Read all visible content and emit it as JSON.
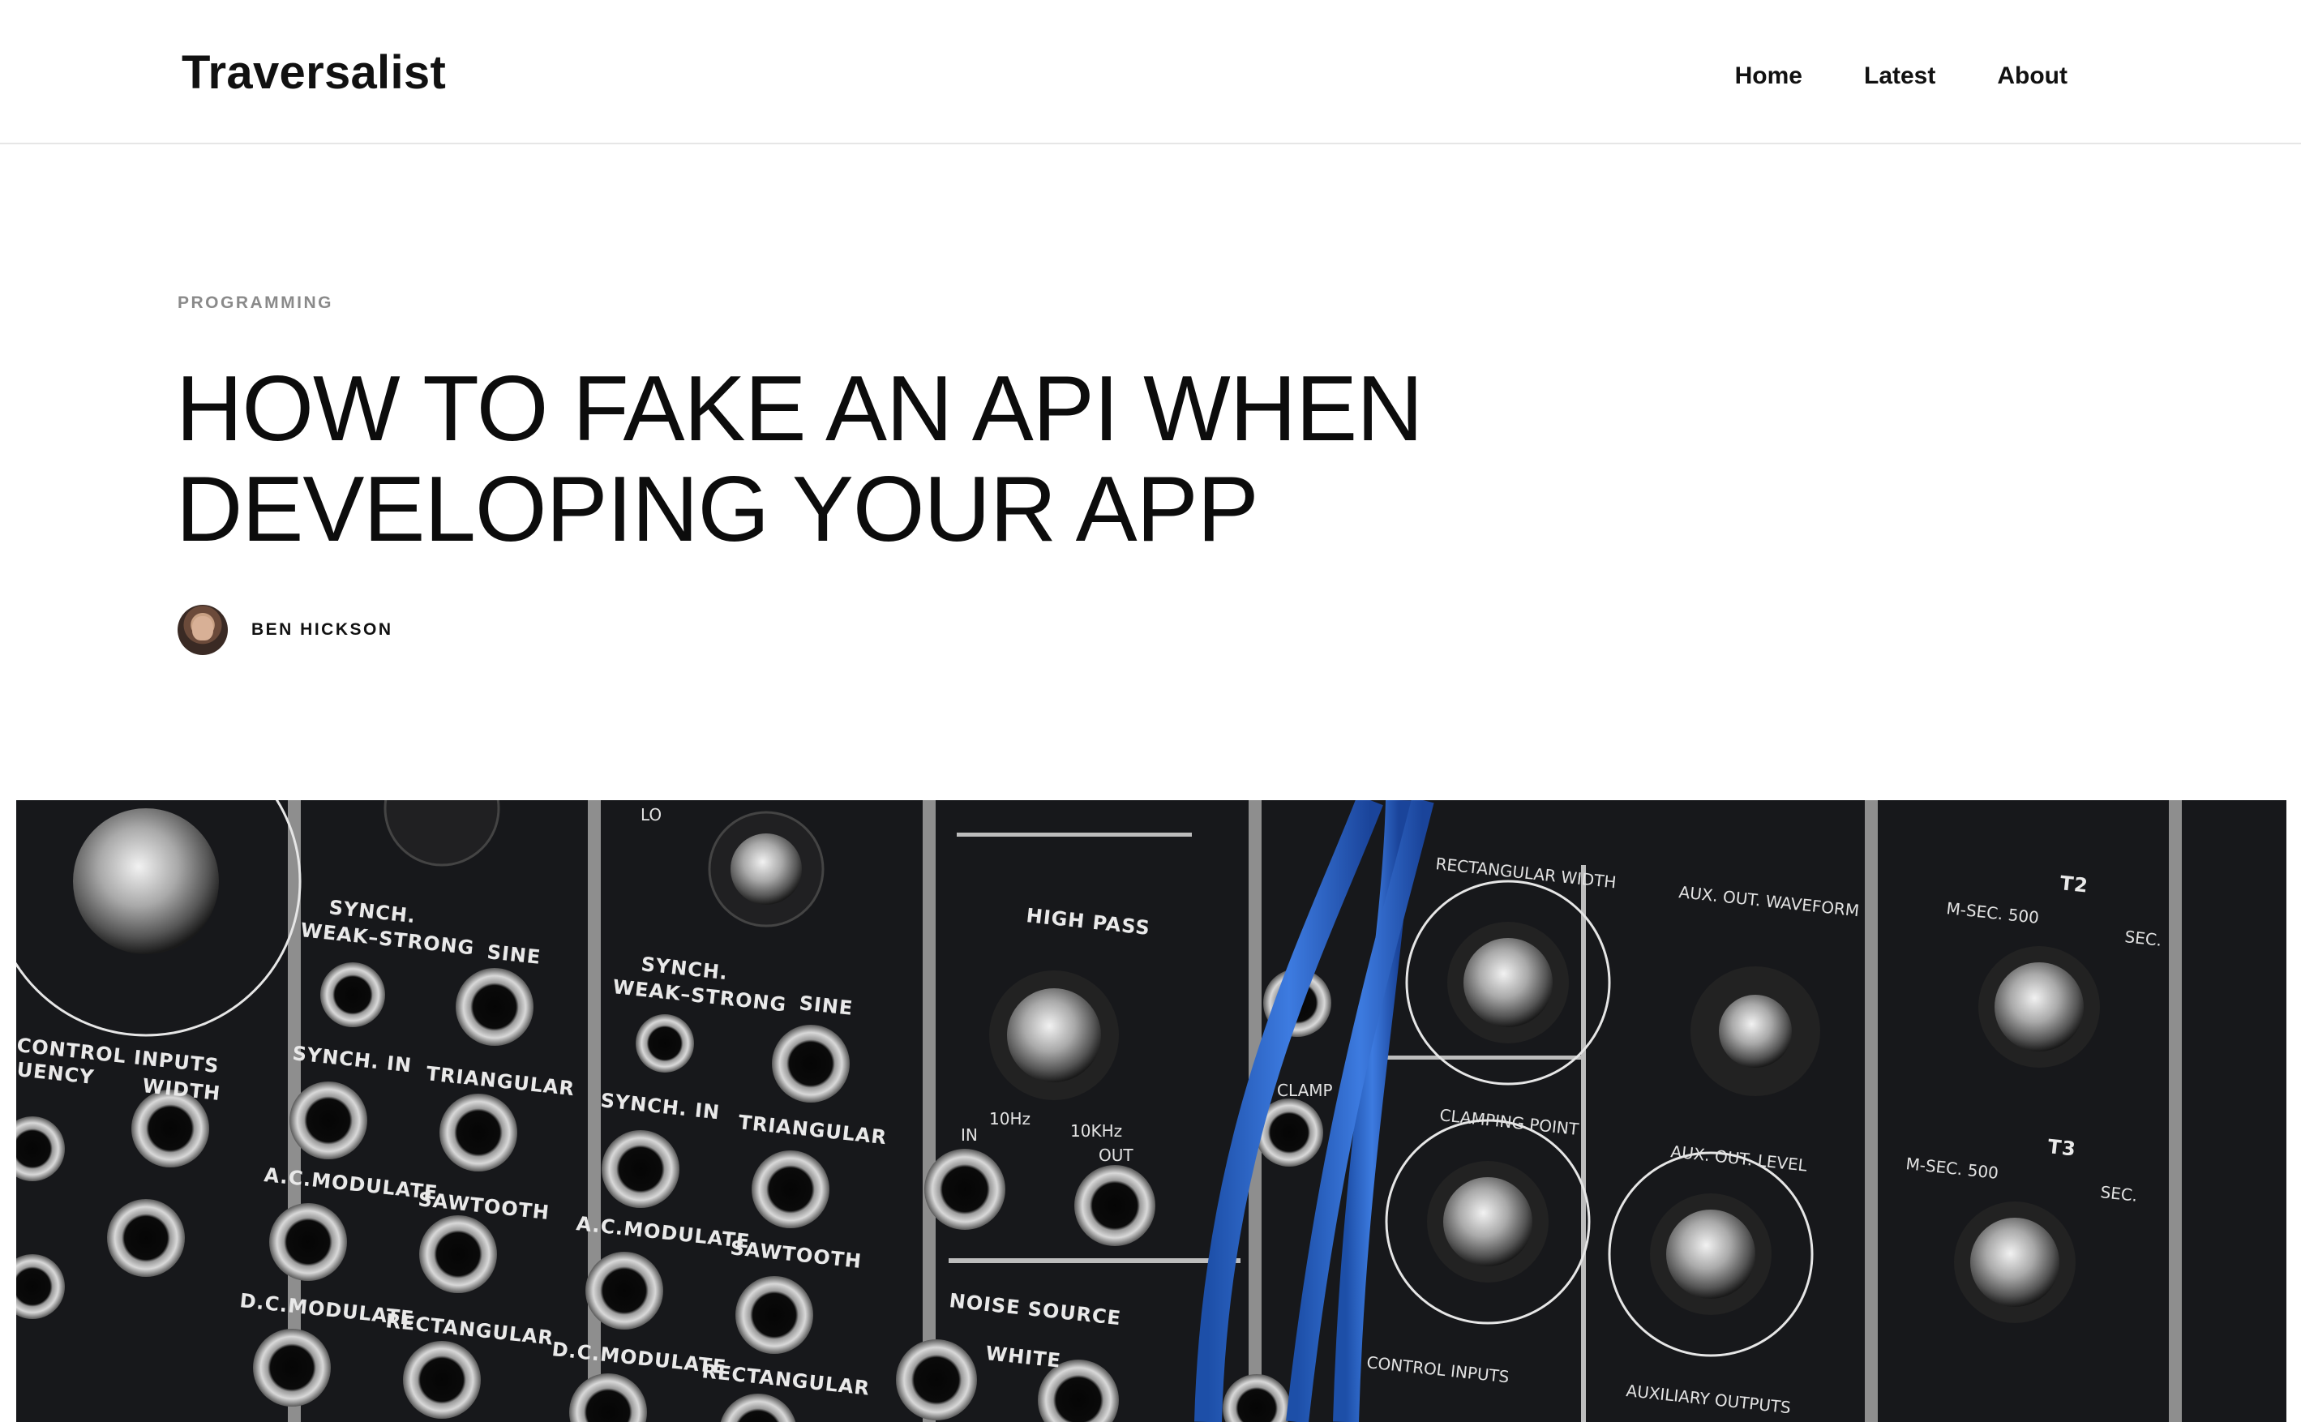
{
  "header": {
    "brand": "Traversalist",
    "nav": [
      {
        "label": "Home"
      },
      {
        "label": "Latest"
      },
      {
        "label": "About"
      }
    ]
  },
  "article": {
    "category": "PROGRAMMING",
    "title_line1": "HOW TO FAKE AN API WHEN",
    "title_line2": "DEVELOPING YOUR APP",
    "author": "BEN HICKSON"
  },
  "hero_labels": {
    "control_inputs": "CONTROL INPUTS",
    "uency": "UENCY",
    "width": "WIDTH",
    "synch_weak_strong_1": "SYNCH.",
    "weak_strong": "WEAK–STRONG",
    "sine": "SINE",
    "synch_in": "SYNCH. IN",
    "triangular": "TRIANGULAR",
    "ac_modulate": "A.C.MODULATE",
    "sawtooth": "SAWTOOTH",
    "dc_modulate": "D.C.MODULATE",
    "rectangular": "RECTANGULAR",
    "high_pass": "HIGH PASS",
    "in": "IN",
    "out": "OUT",
    "hz10": "10Hz",
    "khz10": "10KHz",
    "noise_source": "NOISE SOURCE",
    "white": "WHITE",
    "clamp": "CLAMP",
    "rectangular_width": "RECTANGULAR WIDTH",
    "clamping_point": "CLAMPING POINT",
    "control_inputs_2": "CONTROL INPUTS",
    "aux_out_waveform": "AUX. OUT. WAVEFORM",
    "aux_out_level": "AUX. OUT. LEVEL",
    "auxiliary_outputs": "AUXILIARY OUTPUTS",
    "t2": "T2",
    "t3": "T3",
    "msec500": "M-SEC. 500",
    "sec": "SEC.",
    "lo": "LO"
  }
}
